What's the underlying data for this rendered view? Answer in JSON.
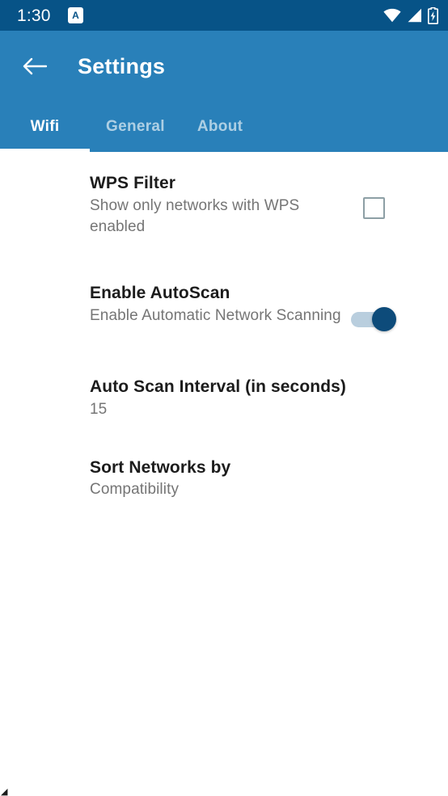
{
  "status_bar": {
    "clock": "1:30",
    "alarm_badge_letter": "A",
    "icons": [
      "wifi-icon",
      "cellular-signal-icon",
      "battery-charging-icon"
    ],
    "background_color": "#075387"
  },
  "app_bar": {
    "back_icon": "back-arrow-icon",
    "title": "Settings",
    "background_color": "#2980b9",
    "tabs": [
      {
        "label": "Wifi",
        "active": true
      },
      {
        "label": "General",
        "active": false
      },
      {
        "label": "About",
        "active": false
      }
    ]
  },
  "preferences": [
    {
      "title": "WPS Filter",
      "summary": "Show only networks with WPS enabled",
      "widget": "checkbox",
      "checked": false
    },
    {
      "title": "Enable AutoScan",
      "summary": "Enable Automatic Network Scanning",
      "widget": "switch",
      "checked": true
    },
    {
      "title": "Auto Scan Interval (in seconds)",
      "summary": "15",
      "widget": "none"
    },
    {
      "title": "Sort Networks by",
      "summary": "Compatibility",
      "widget": "none"
    }
  ],
  "colors": {
    "status_bar": "#075387",
    "app_bar": "#2980b9",
    "title_text": "#1c1c1c",
    "summary_text": "#757575",
    "checkbox_border": "#8d9fa5",
    "switch_track": "#b9cede",
    "switch_thumb": "#0d4b7a"
  }
}
